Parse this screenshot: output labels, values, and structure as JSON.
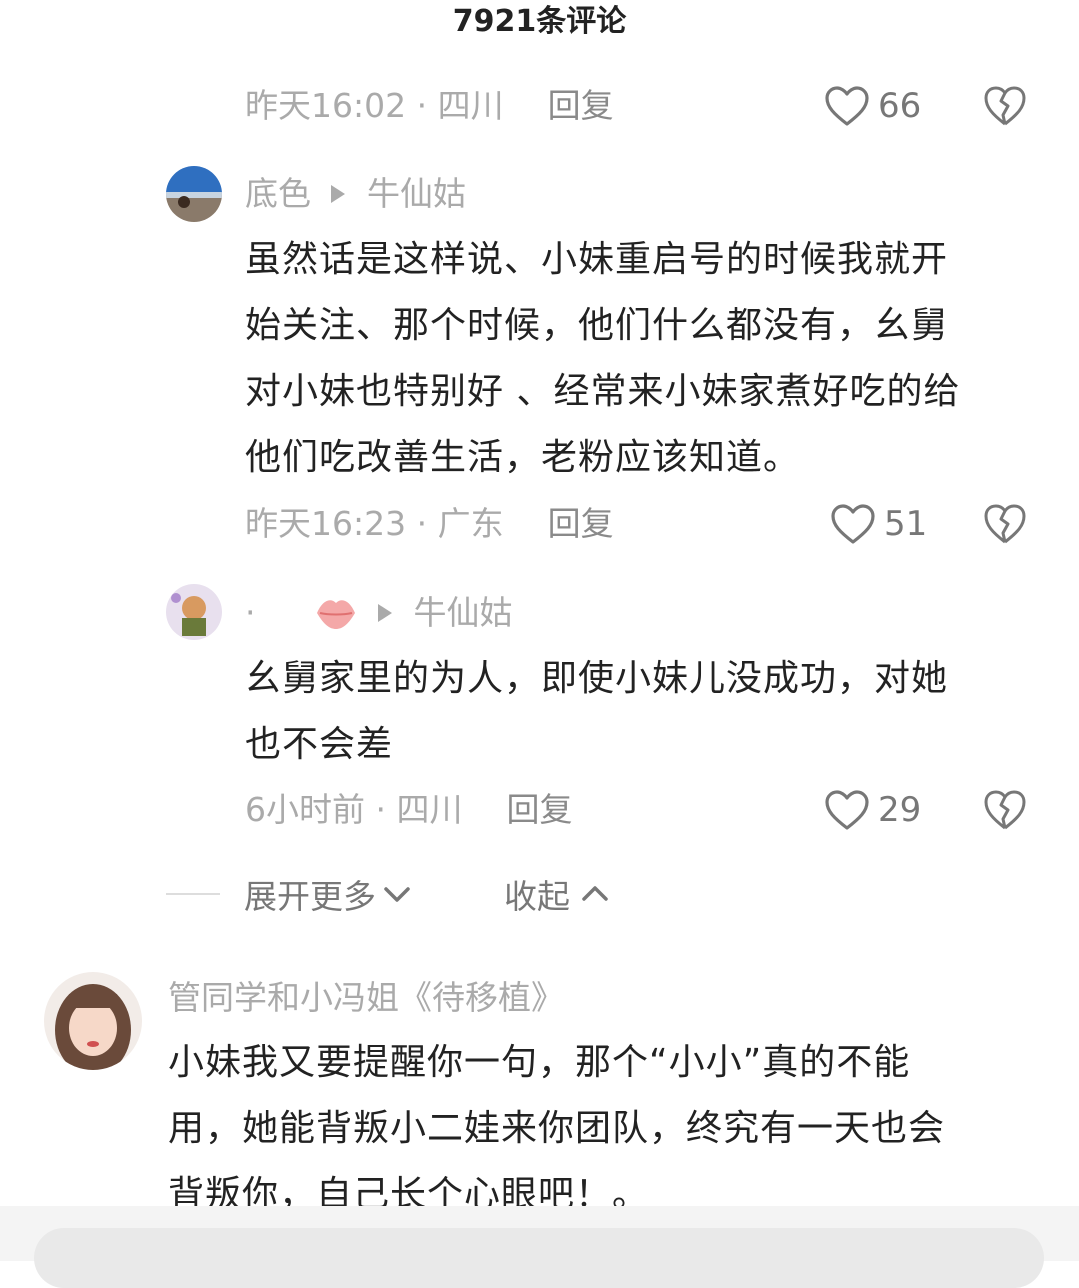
{
  "header": {
    "title": "7921条评论"
  },
  "comment0": {
    "meta": "昨天16:02 · 四川",
    "reply": "回复",
    "likes": "66"
  },
  "comment1": {
    "user": "底色",
    "reply_to": "牛仙姑",
    "lines": [
      "虽然话是这样说、小妹重启号的时候我就开",
      "始关注、那个时候，他们什么都没有，幺舅",
      "对小妹也特别好 、经常来小妹家煮好吃的给",
      "他们吃改善生活，老粉应该知道。"
    ],
    "meta": "昨天16:23 · 广东",
    "reply": "回复",
    "likes": "51"
  },
  "comment2": {
    "user": "·",
    "reply_to": "牛仙姑",
    "lines": [
      "幺舅家里的为人，即使小妹儿没成功，对她",
      "也不会差"
    ],
    "meta": "6小时前 · 四川",
    "reply": "回复",
    "likes": "29"
  },
  "expand": {
    "more": "展开更多",
    "collapse": "收起"
  },
  "comment3": {
    "user": "管同学和小冯姐《待移植》",
    "lines": [
      "小妹我又要提醒你一句，那个“小小”真的不能",
      "用，她能背叛小二娃来你团队，终究有一天也会",
      "背叛你，自己长个心眼吧！。"
    ]
  },
  "icons": [
    "heart-outline-icon",
    "broken-heart-icon",
    "chevron-down-icon",
    "chevron-up-icon",
    "lips-icon"
  ]
}
